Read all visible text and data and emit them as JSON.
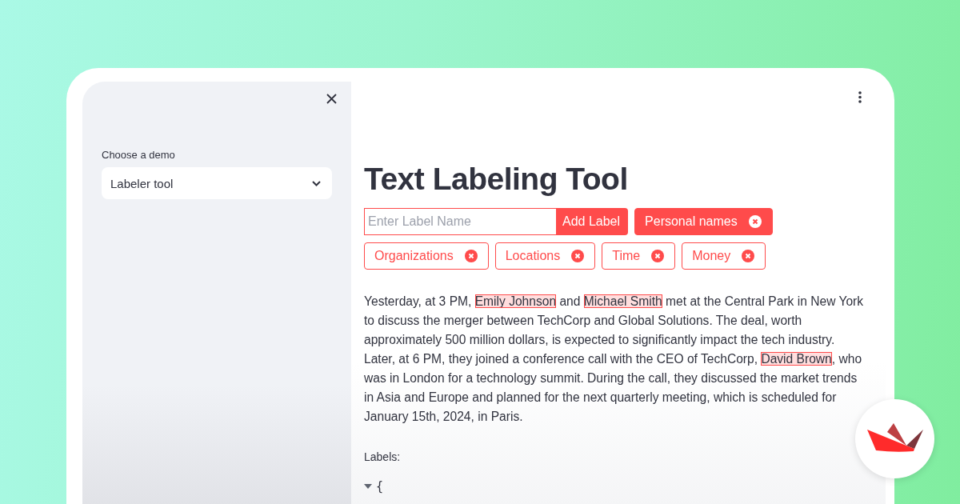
{
  "sidebar": {
    "select": {
      "label": "Choose a demo",
      "value": "Labeler tool"
    }
  },
  "main": {
    "title": "Text Labeling Tool",
    "label_input": {
      "placeholder": "Enter Label Name",
      "button": "Add Label"
    },
    "labels": [
      {
        "label": "Personal names",
        "selected": true
      },
      {
        "label": "Organizations",
        "selected": false
      },
      {
        "label": "Locations",
        "selected": false
      },
      {
        "label": "Time",
        "selected": false
      },
      {
        "label": "Money",
        "selected": false
      }
    ],
    "paragraph": [
      {
        "text": "Yesterday, at 3 PM, ",
        "highlighted": false
      },
      {
        "text": "Emily Johnson",
        "highlighted": true
      },
      {
        "text": " and ",
        "highlighted": false
      },
      {
        "text": "Michael Smith",
        "highlighted": true
      },
      {
        "text": " met at the Central Park in New York to discuss the merger between TechCorp and Global Solutions. The deal, worth approximately 500 million dollars, is expected to significantly impact the tech industry. Later, at 6 PM, they joined a conference call with the CEO of TechCorp, ",
        "highlighted": false
      },
      {
        "text": "David Brown",
        "highlighted": true
      },
      {
        "text": ", who was in London for a technology summit. During the call, they discussed the market trends in Asia and Europe and planned for the next quarterly meeting, which is scheduled for January 15th, 2024, in Paris.",
        "highlighted": false
      }
    ],
    "labels_caption": "Labels:",
    "json_view": {
      "expanded": true,
      "text": "{"
    }
  }
}
